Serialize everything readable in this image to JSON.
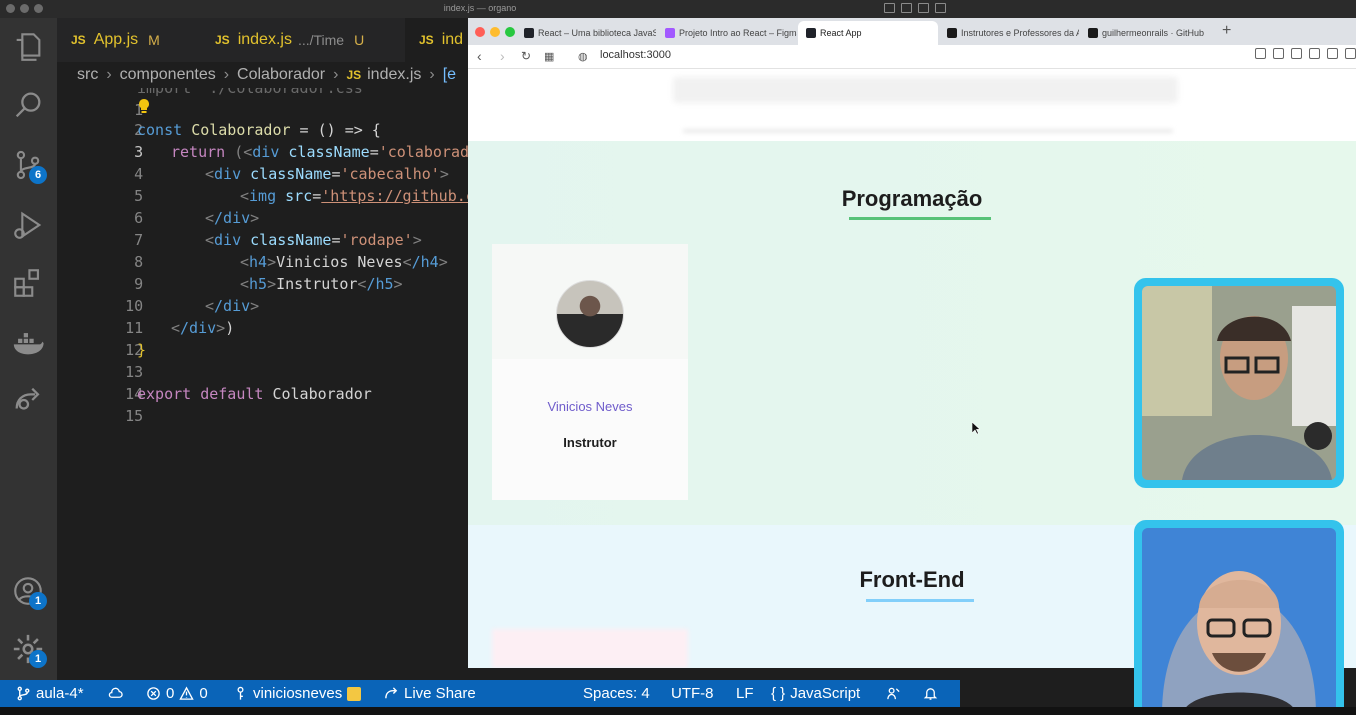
{
  "vscode": {
    "window_title": "index.js — organo",
    "tabs": [
      {
        "file": "App.js",
        "desc": "",
        "status": "M"
      },
      {
        "file": "index.js",
        "desc": ".../Time",
        "status": "U"
      },
      {
        "file": "ind",
        "desc": "",
        "status": ""
      }
    ],
    "js_badge": "JS",
    "breadcrumb": [
      "src",
      "componentes",
      "Colaborador",
      "index.js",
      "[e"
    ],
    "line_numbers": [
      "1",
      "2",
      "3",
      "4",
      "5",
      "6",
      "7",
      "8",
      "9",
      "10",
      "11",
      "12",
      "13",
      "14",
      "15"
    ],
    "code": {
      "l1": "import './Colaborador.css'",
      "l3_kw": "const",
      "l3_name": "Colaborador",
      "l3_rest": " = () => {",
      "l4_kw": "return",
      "l4_a": " (<",
      "l4_tag": "div",
      "l4_attr": " className",
      "l4_eq": "=",
      "l4_str": "'colaborado",
      "l5_tag": "div",
      "l5_attr": " className",
      "l5_str": "'cabecalho'",
      "l6_tag": "img",
      "l6_attr": " src",
      "l6_str": "'https://github.c",
      "l7_tag": "/div",
      "l8_tag": "div",
      "l8_attr": " className",
      "l8_str": "'rodape'",
      "l9_tag": "h4",
      "l9_text": "Vinicios Neves",
      "l9_close": "/h4",
      "l10_tag": "h5",
      "l10_text": "Instrutor",
      "l10_close": "/h5",
      "l11_tag": "/div",
      "l12_tag": "/div",
      "l12_end": ")",
      "l13": "}",
      "l15_a": "export default",
      "l15_b": " Colaborador"
    },
    "activity_badges": {
      "source_control": "6",
      "accounts": "1",
      "settings": "1"
    },
    "status": {
      "branch": "aula-4*",
      "errors": "0",
      "warnings": "0",
      "user": "viniciosneves",
      "live_share": "Live Share",
      "spaces": "Spaces: 4",
      "encoding": "UTF-8",
      "eol": "LF",
      "language": "JavaScript"
    }
  },
  "browser": {
    "tabs": [
      {
        "label": "React – Uma biblioteca JavaSc",
        "fav_color": "#20232a"
      },
      {
        "label": "Projeto Intro ao React – Figma",
        "fav_color": "#a259ff"
      },
      {
        "label": "React App",
        "fav_color": "#20232a"
      },
      {
        "label": "Instrutores e Professores da Al",
        "fav_color": "#1a1a1a"
      },
      {
        "label": "guilhermeonrails · GitHub",
        "fav_color": "#1a1a1a"
      }
    ],
    "url": "localhost:3000",
    "teams": [
      {
        "name": "Programação",
        "primary": "#57c278",
        "secondary": "#d9f7e9"
      },
      {
        "name": "Front-End",
        "primary": "#82cffa",
        "secondary": "#e8f8ff"
      }
    ],
    "card": {
      "name": "Vinicios Neves",
      "role": "Instrutor",
      "name_color": "#6f5ccb"
    }
  },
  "colors": {
    "statusbar": "#0a64b8",
    "activity_bar": "#333333",
    "editor_bg": "#1e1e1e",
    "webcam_border": "#34c3ec"
  }
}
